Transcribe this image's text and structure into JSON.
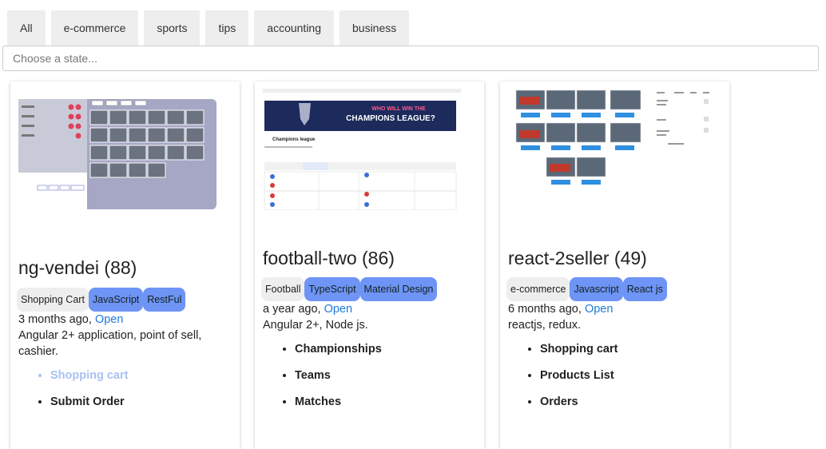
{
  "filters": {
    "tabs": [
      "All",
      "e-commerce",
      "sports",
      "tips",
      "accounting",
      "business"
    ],
    "state_placeholder": "Choose a state..."
  },
  "colors": {
    "tag_blue": "#6e94f5",
    "tag_grey": "#eeeeee",
    "link": "#1f7ad8"
  },
  "cards": [
    {
      "title": "ng-vendei (88)",
      "tags": [
        "Shopping Cart",
        "JavaScript",
        "RestFul"
      ],
      "age": "3 months ago,",
      "open": "Open",
      "description": "Angular 2+ application, point of sell, cashier.",
      "features": [
        "Shopping cart",
        "Submit Order"
      ]
    },
    {
      "title": "football-two (86)",
      "tags": [
        "Football",
        "TypeScript",
        "Material Design"
      ],
      "age": "a year ago,",
      "open": "Open",
      "description": "Angular 2+, Node js.",
      "thumb_banner": "WHO WILL WIN THE",
      "thumb_banner2": "CHAMPIONS LEAGUE?",
      "thumb_heading": "Champions league",
      "features": [
        "Championships",
        "Teams",
        "Matches"
      ]
    },
    {
      "title": "react-2seller (49)",
      "tags": [
        "e-commerce",
        "Javascript",
        "React js"
      ],
      "age": "6 months ago,",
      "open": "Open",
      "description": "reactjs, redux.",
      "features": [
        "Shopping cart",
        "Products List",
        "Orders"
      ]
    }
  ]
}
